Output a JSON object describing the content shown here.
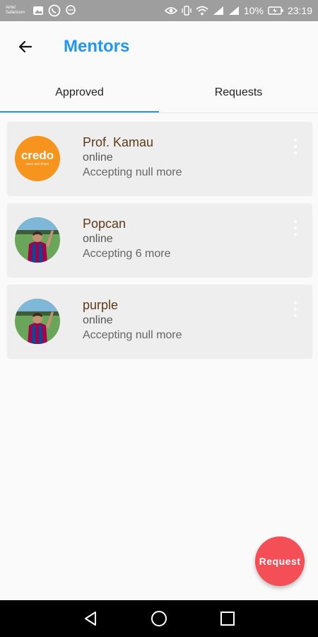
{
  "status_bar": {
    "carrier_line1": "Airtel",
    "carrier_line2": "Safaricom",
    "battery": "10%",
    "time": "23:19"
  },
  "app_bar": {
    "title": "Mentors"
  },
  "tabs": [
    {
      "label": "Approved",
      "active": true
    },
    {
      "label": "Requests",
      "active": false
    }
  ],
  "mentors": [
    {
      "name": "Prof. Kamau",
      "status": "online",
      "accepting": "Accepting null more",
      "avatar": "credo-logo",
      "avatar_text": "credo",
      "avatar_subtext": "Save and Share"
    },
    {
      "name": "Popcan",
      "status": "online",
      "accepting": "Accepting 6 more",
      "avatar": "player-photo"
    },
    {
      "name": "purple",
      "status": "online",
      "accepting": "Accepting null more",
      "avatar": "player-photo"
    }
  ],
  "fab": {
    "label": "Request"
  },
  "colors": {
    "accent": "#2196f3",
    "fab": "#f44e56",
    "name": "#5d3a1a"
  }
}
